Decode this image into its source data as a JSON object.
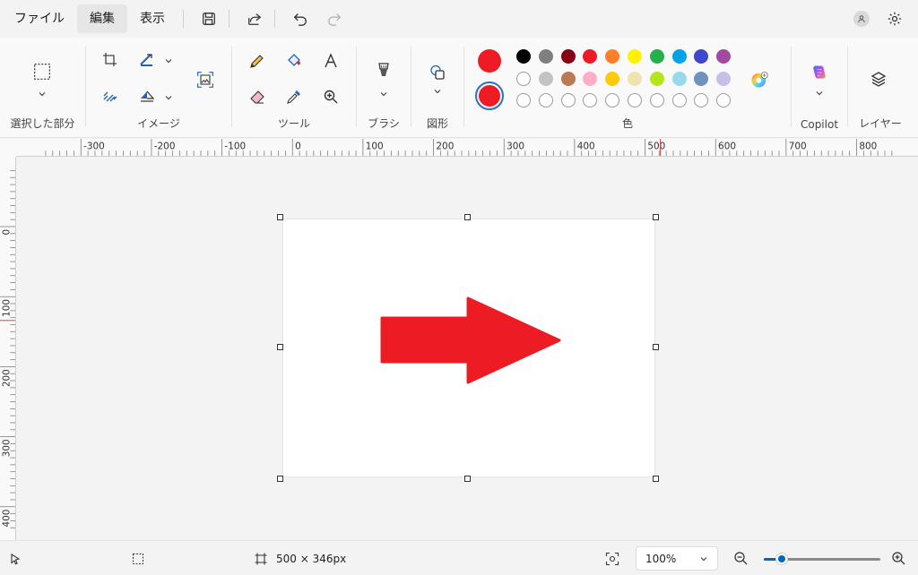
{
  "menu": {
    "file": "ファイル",
    "edit": "編集",
    "view": "表示"
  },
  "ribbon": {
    "selection_label": "選択した部分",
    "image_label": "イメージ",
    "tools_label": "ツール",
    "brush_label": "ブラシ",
    "shapes_label": "図形",
    "colors_label": "色",
    "copilot_label": "Copilot",
    "layers_label": "レイヤー",
    "primary_color": "#ed1c24",
    "secondary_color": "#ed1c24",
    "palette_row1": [
      "#000000",
      "#7f7f7f",
      "#880015",
      "#ed1c24",
      "#ff7f27",
      "#fff200",
      "#22b14c",
      "#00a2e8",
      "#3f48cc",
      "#a349a4"
    ],
    "palette_row2": [
      "#ffffff",
      "#c3c3c3",
      "#b97a57",
      "#ffaec9",
      "#ffc90e",
      "#efe4b0",
      "#b5e61d",
      "#99d9ea",
      "#7092be",
      "#c8bfe7"
    ]
  },
  "ruler": {
    "h_labels": [
      "-300",
      "-200",
      "-100",
      "0",
      "100",
      "200",
      "300",
      "400",
      "500",
      "600",
      "700",
      "800"
    ],
    "v_labels": [
      "0",
      "100",
      "200",
      "300",
      "400"
    ]
  },
  "canvas": {
    "arrow_color": "#ed1c24"
  },
  "status": {
    "canvas_size": "500 × 346px",
    "zoom": "100%",
    "zoom_slider_fraction": 0.15
  }
}
